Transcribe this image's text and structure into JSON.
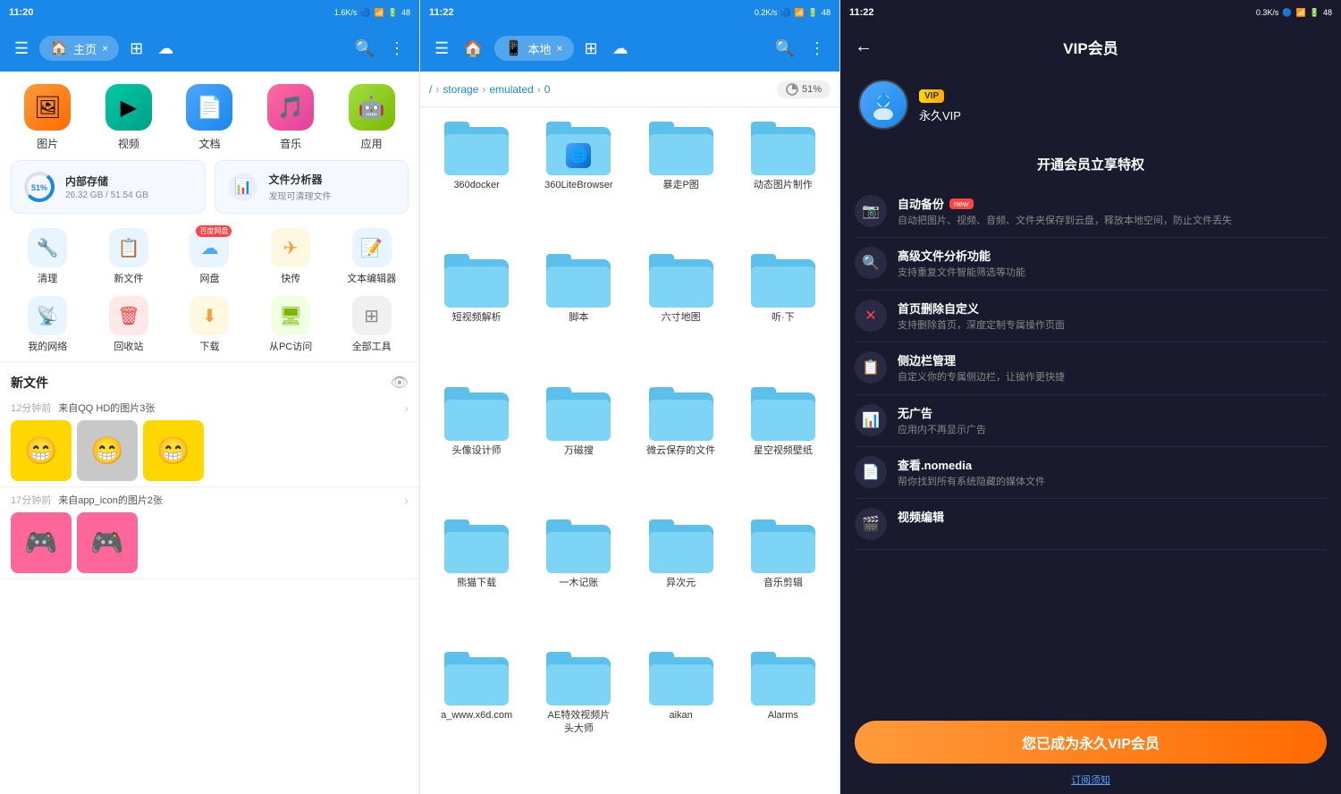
{
  "panel1": {
    "status": {
      "time": "11:20",
      "network": "1.6K/s",
      "battery": "48"
    },
    "topbar": {
      "menu_icon": "☰",
      "tab_label": "主页",
      "tab_close": "×",
      "search_icon": "🔍",
      "more_icon": "⋮"
    },
    "categories": [
      {
        "label": "图片",
        "emoji": "🖼",
        "color_class": "cat-orange"
      },
      {
        "label": "视频",
        "emoji": "▶",
        "color_class": "cat-teal"
      },
      {
        "label": "文档",
        "emoji": "📄",
        "color_class": "cat-blue"
      },
      {
        "label": "音乐",
        "emoji": "🎵",
        "color_class": "cat-pink"
      },
      {
        "label": "应用",
        "emoji": "🤖",
        "color_class": "cat-green"
      }
    ],
    "storage": {
      "internal": {
        "title": "内部存储",
        "used": "26.32 GB",
        "total": "51.54 GB",
        "pct": 51
      },
      "analyzer": {
        "title": "文件分析器",
        "sub": "发现可清理文件"
      }
    },
    "tools_row1": [
      {
        "label": "清理",
        "emoji": "🔧"
      },
      {
        "label": "新文件",
        "emoji": "📋"
      },
      {
        "label": "网盘",
        "emoji": "☁",
        "badge": "百度网盘"
      },
      {
        "label": "快传",
        "emoji": "✈"
      },
      {
        "label": "文本编辑器",
        "emoji": "📝"
      }
    ],
    "tools_row2": [
      {
        "label": "我的网络",
        "emoji": "📡"
      },
      {
        "label": "回收站",
        "emoji": "🗑"
      },
      {
        "label": "下载",
        "emoji": "⬇"
      },
      {
        "label": "从PC访问",
        "emoji": "🖥"
      },
      {
        "label": "全部工具",
        "emoji": "⊞"
      }
    ],
    "new_files_title": "新文件",
    "file_groups": [
      {
        "time": "12分钟前",
        "source": "来自QQ HD的图片3张",
        "thumbs": [
          "😁",
          "😁",
          "😁"
        ]
      },
      {
        "time": "17分钟前",
        "source": "来自app_icon的图片2张",
        "thumbs": [
          "🎮",
          "🎮"
        ]
      }
    ]
  },
  "panel2": {
    "status": {
      "time": "11:22",
      "network": "0.2K/s",
      "battery": "48"
    },
    "topbar": {
      "menu_icon": "☰",
      "tab_label": "本地",
      "tab_close": "×",
      "search_icon": "🔍",
      "more_icon": "⋮"
    },
    "breadcrumb": [
      "storage",
      "emulated",
      "0"
    ],
    "storage_pct": "51%",
    "folders": [
      {
        "name": "360docker",
        "has_app": false
      },
      {
        "name": "360LiteBrowser",
        "has_app": true,
        "app_emoji": "🌐"
      },
      {
        "name": "暴走P图",
        "has_app": false
      },
      {
        "name": "动态图片制作",
        "has_app": false
      },
      {
        "name": "短视频解析",
        "has_app": false
      },
      {
        "name": "脚本",
        "has_app": false
      },
      {
        "name": "六寸地图",
        "has_app": false
      },
      {
        "name": "听·下",
        "has_app": false
      },
      {
        "name": "头像设计师",
        "has_app": false
      },
      {
        "name": "万磁搜",
        "has_app": false
      },
      {
        "name": "微云保存的文件",
        "has_app": false
      },
      {
        "name": "星空视频壁纸",
        "has_app": false
      },
      {
        "name": "熊猫下载",
        "has_app": false
      },
      {
        "name": "一木记账",
        "has_app": false
      },
      {
        "name": "异次元",
        "has_app": false
      },
      {
        "name": "音乐剪辑",
        "has_app": false
      },
      {
        "name": "a_www.x6d.com",
        "has_app": false
      },
      {
        "name": "AE特效视频片头大师",
        "has_app": false
      },
      {
        "name": "aikan",
        "has_app": false
      },
      {
        "name": "Alarms",
        "has_app": false
      }
    ]
  },
  "panel3": {
    "status": {
      "time": "11:22",
      "network": "0.3K/s",
      "battery": "48"
    },
    "back_icon": "←",
    "title": "VIP会员",
    "avatar_emoji": "🔷",
    "vip_badge": "VIP",
    "username": "永久VIP",
    "benefits_title": "开通会员立享特权",
    "benefits": [
      {
        "icon": "📷",
        "color_class": "benefit-icon-orange",
        "name": "自动备份",
        "is_new": true,
        "desc": "自动把图片、视频、音频、文件夹保存到云盘，释放本地空间，防止文件丢失"
      },
      {
        "icon": "🔍",
        "color_class": "benefit-icon-blue",
        "name": "高级文件分析功能",
        "is_new": false,
        "desc": "支持重复文件智能筛选等功能"
      },
      {
        "icon": "✕",
        "color_class": "benefit-icon-red",
        "name": "首页删除自定义",
        "is_new": false,
        "desc": "支持删除首页，深度定制专属操作页面"
      },
      {
        "icon": "📋",
        "color_class": "benefit-icon-green",
        "name": "侧边栏管理",
        "is_new": false,
        "desc": "自定义你的专属侧边栏，让操作更快捷"
      },
      {
        "icon": "📊",
        "color_class": "benefit-icon-yellow",
        "name": "无广告",
        "is_new": false,
        "desc": "应用内不再显示广告"
      },
      {
        "icon": "📄",
        "color_class": "benefit-icon-blue",
        "name": "查看.nomedia",
        "is_new": false,
        "desc": "帮你找到所有系统隐藏的媒体文件"
      },
      {
        "icon": "🎬",
        "color_class": "benefit-icon-orange",
        "name": "视频编辑",
        "is_new": false,
        "desc": ""
      }
    ],
    "cta_label": "您已成为永久VIP会员",
    "sub_label": "订阅须知"
  }
}
